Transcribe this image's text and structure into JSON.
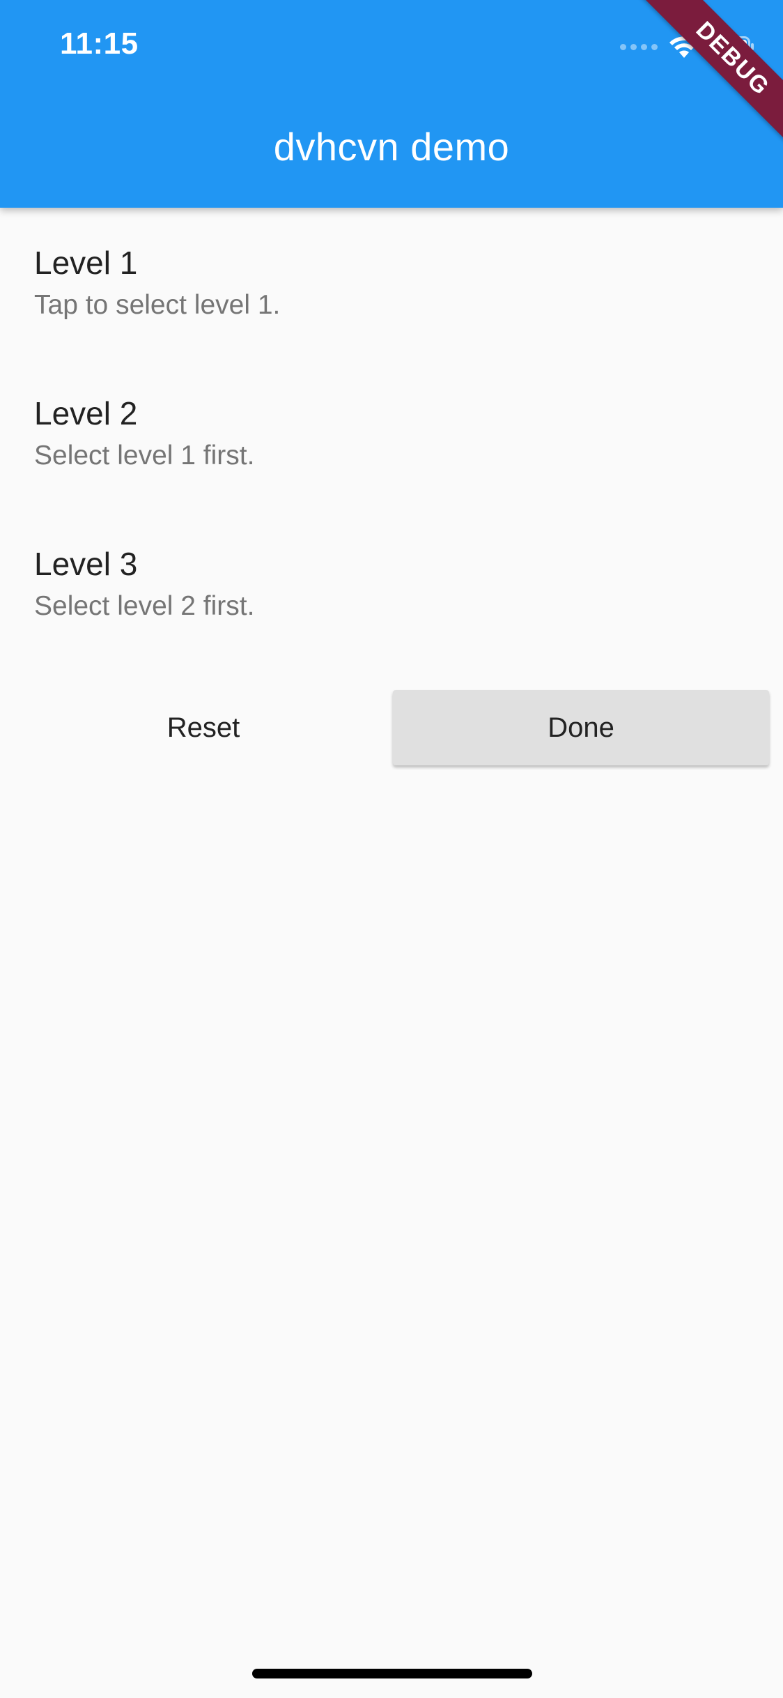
{
  "status_bar": {
    "time": "11:15",
    "icons": [
      "cellular-signal-icon",
      "wifi-icon",
      "battery-icon"
    ]
  },
  "app_bar": {
    "title": "dvhcvn demo",
    "background_color": "#2196f3",
    "debug_banner": "DEBUG",
    "debug_banner_color": "#7b1c3d"
  },
  "levels": [
    {
      "title": "Level 1",
      "subtitle": "Tap to select level 1."
    },
    {
      "title": "Level 2",
      "subtitle": "Select level 1 first."
    },
    {
      "title": "Level 3",
      "subtitle": "Select level 2 first."
    }
  ],
  "buttons": {
    "reset_label": "Reset",
    "done_label": "Done"
  }
}
